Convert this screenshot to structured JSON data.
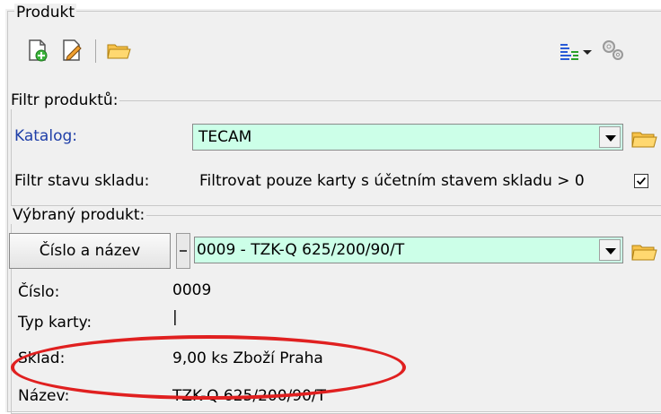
{
  "group_product": {
    "title": "Produkt"
  },
  "toolbar": {
    "icons": [
      "new-card-icon",
      "edit-card-icon",
      "open-folder-icon",
      "column-settings-icon",
      "dropdown-arrow-icon",
      "gears-icon"
    ]
  },
  "filter": {
    "title": "Filtr produktů:",
    "catalog_label": "Katalog:",
    "catalog_value": "TECAM",
    "stock_filter_label": "Filtr stavu skladu:",
    "stock_filter_text": "Filtrovat pouze karty s účetním stavem skladu > 0",
    "stock_filter_checked": true
  },
  "selected": {
    "title": "Výbraný produkt:",
    "mode_button": "Číslo a název",
    "product_value": "0009 - TZK-Q 625/200/90/T",
    "fields": [
      {
        "label": "Číslo:",
        "value": "0009"
      },
      {
        "label": "Typ karty:",
        "value": "|"
      },
      {
        "label": "Sklad:",
        "value": "9,00 ks Zboží Praha"
      },
      {
        "label": "Název:",
        "value": "TZK-Q 625/200/90/T"
      }
    ]
  },
  "colors": {
    "accent_label": "#1f3fa8",
    "combo_bg": "#ccffe8",
    "highlight": "#e02020"
  }
}
